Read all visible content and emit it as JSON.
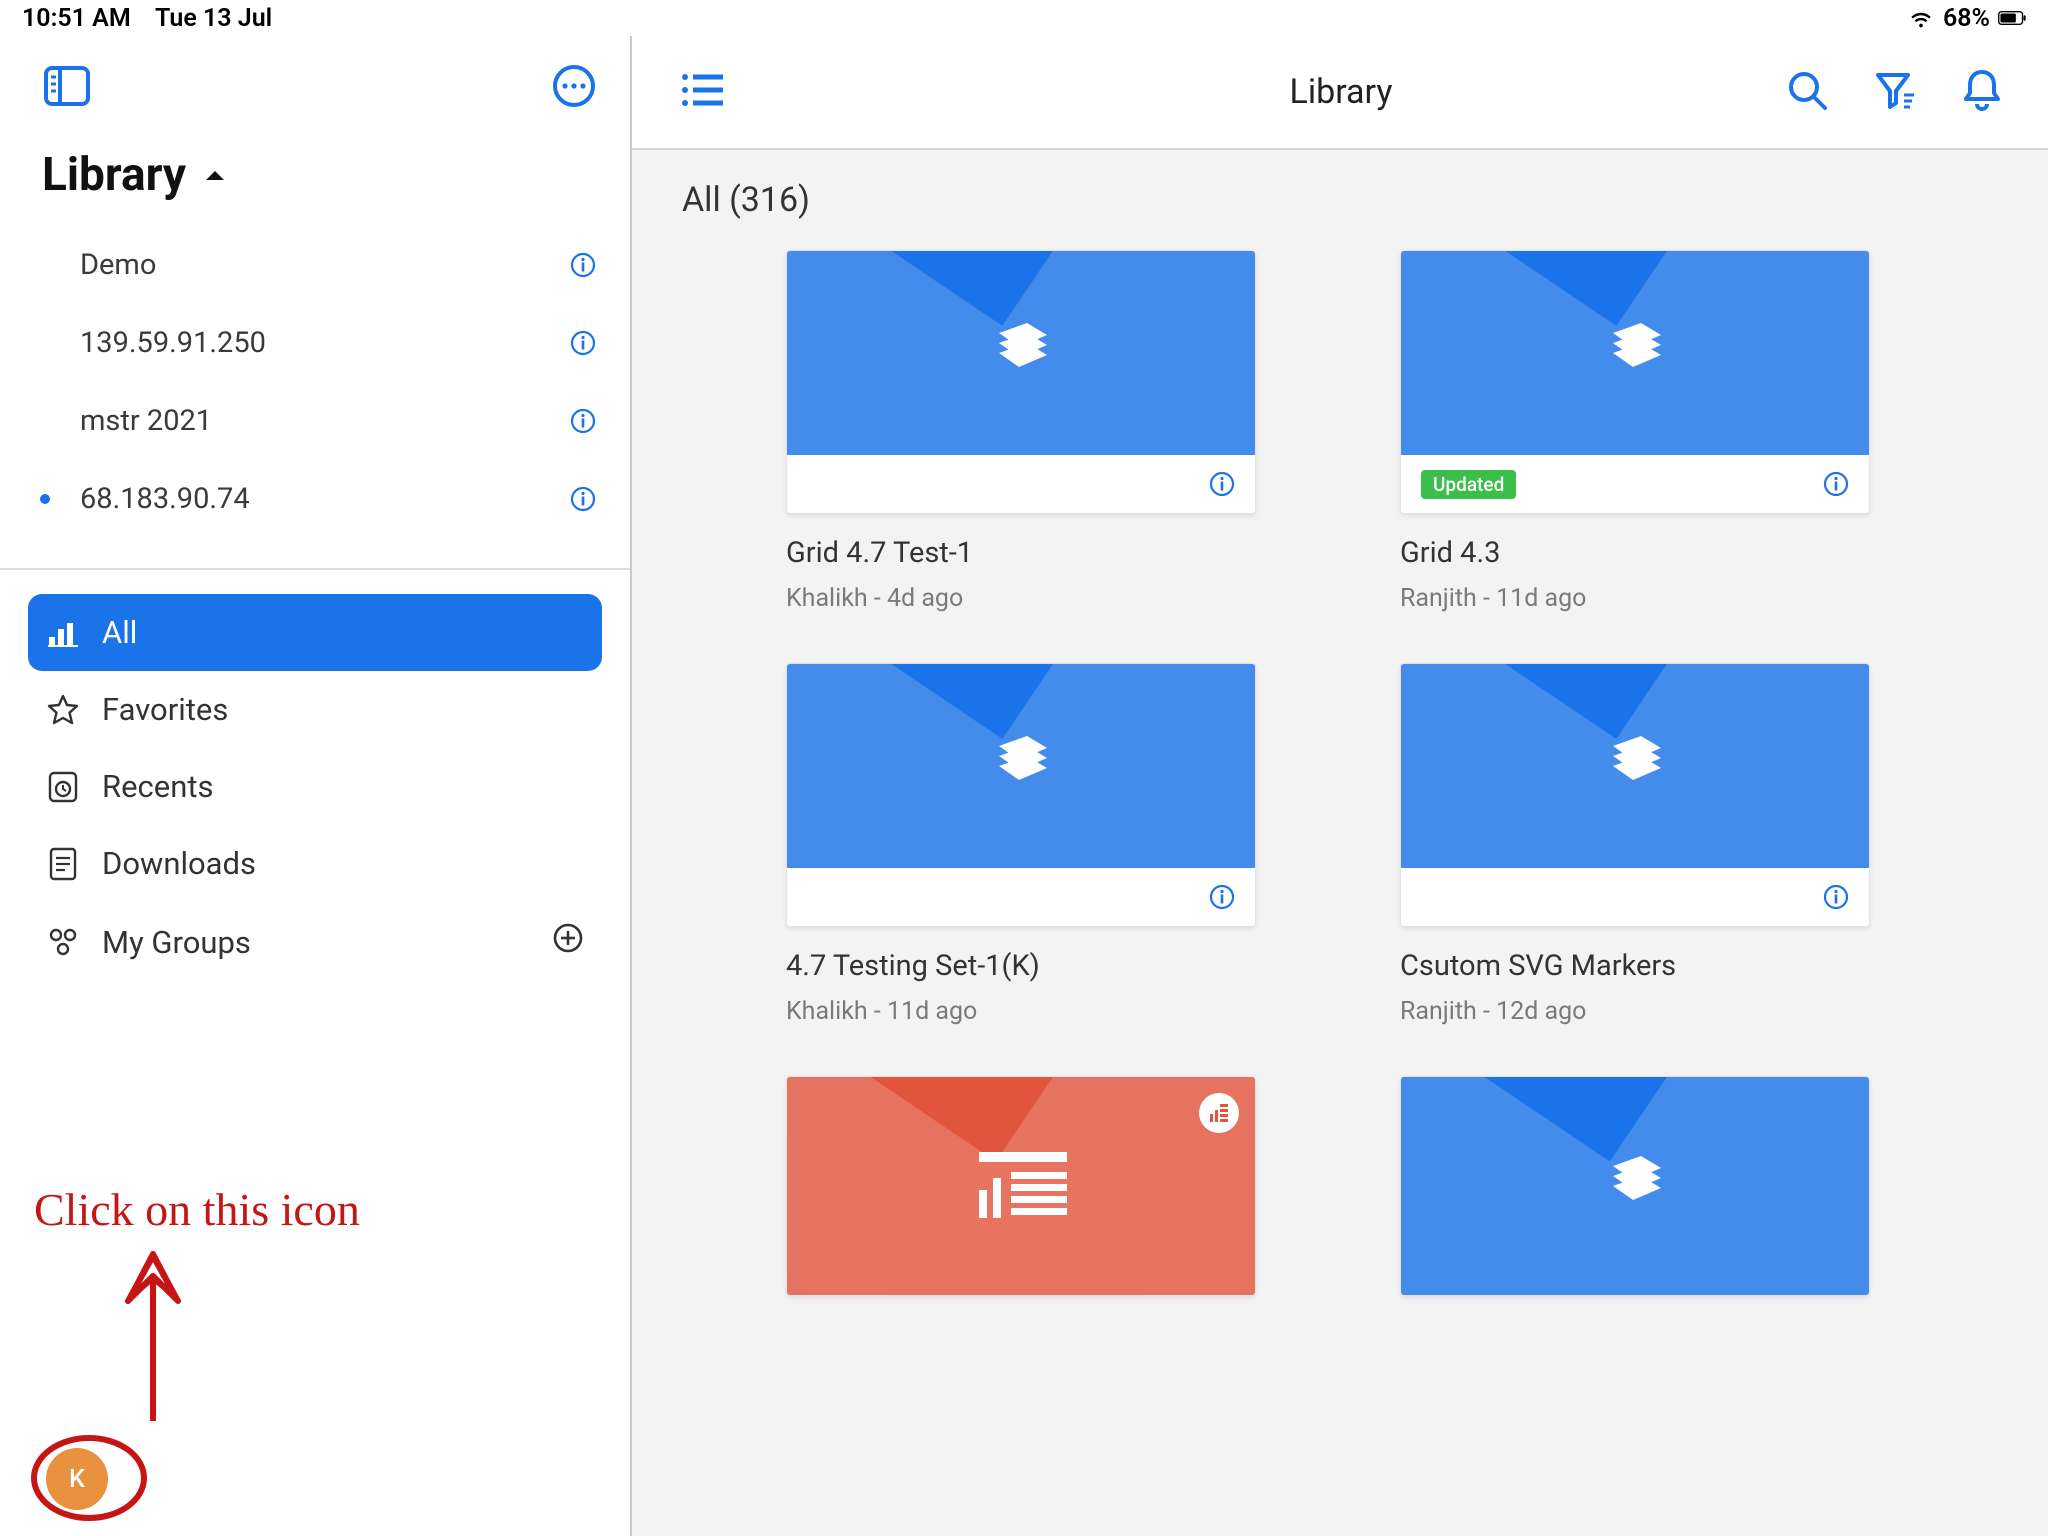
{
  "status": {
    "time": "10:51 AM",
    "date": "Tue 13 Jul",
    "battery": "68%"
  },
  "sidebar": {
    "title": "Library",
    "servers": [
      {
        "name": "Demo",
        "active": false
      },
      {
        "name": "139.59.91.250",
        "active": false
      },
      {
        "name": "mstr 2021",
        "active": false
      },
      {
        "name": "68.183.90.74",
        "active": true
      }
    ],
    "nav": {
      "all": "All",
      "favorites": "Favorites",
      "recents": "Recents",
      "downloads": "Downloads",
      "mygroups": "My Groups"
    },
    "avatar_initial": "K"
  },
  "annotation": {
    "text": "Click on this icon"
  },
  "main": {
    "title": "Library",
    "category_label": "All (316)",
    "updated_badge": "Updated",
    "cards": [
      {
        "title": "Grid 4.7 Test-1",
        "sub": "Khalikh - 4d ago",
        "updated": false,
        "color": "blue"
      },
      {
        "title": "Grid 4.3",
        "sub": "Ranjith - 11d ago",
        "updated": true,
        "color": "blue"
      },
      {
        "title": "4.7 Testing Set-1(K)",
        "sub": "Khalikh - 11d ago",
        "updated": false,
        "color": "blue"
      },
      {
        "title": "Csutom SVG Markers",
        "sub": "Ranjith - 12d ago",
        "updated": false,
        "color": "blue"
      },
      {
        "title": "",
        "sub": "",
        "updated": false,
        "color": "red",
        "corner": true
      },
      {
        "title": "",
        "sub": "",
        "updated": false,
        "color": "blue"
      }
    ]
  }
}
